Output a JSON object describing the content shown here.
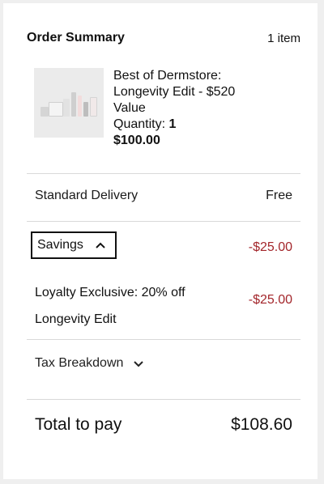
{
  "summary": {
    "title": "Order Summary",
    "item_count": "1 item"
  },
  "product": {
    "name": "Best of Dermstore: Longevity Edit - $520 Value",
    "quantity_label": "Quantity:",
    "quantity_value": "1",
    "price": "$100.00",
    "thumbnail_icon": "product-thumbnail-image"
  },
  "delivery": {
    "label": "Standard Delivery",
    "value": "Free"
  },
  "savings": {
    "toggle_label": "Savings",
    "toggle_icon": "chevron-up-icon",
    "total": "-$25.00",
    "items": [
      {
        "label": "Loyalty Exclusive: 20% off Longevity Edit",
        "amount": "-$25.00"
      }
    ]
  },
  "tax": {
    "toggle_label": "Tax Breakdown",
    "toggle_icon": "chevron-down-icon"
  },
  "total": {
    "label": "Total to pay",
    "value": "$108.60"
  },
  "colors": {
    "discount": "#a3262b",
    "divider": "#d9d9d9",
    "page_bg": "#efefef"
  }
}
